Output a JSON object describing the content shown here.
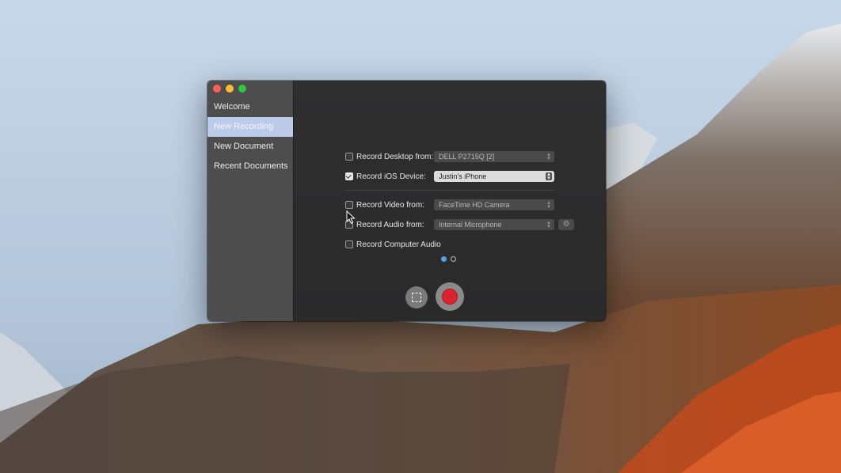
{
  "sidebar": {
    "items": [
      {
        "label": "Welcome",
        "selected": false
      },
      {
        "label": "New Recording",
        "selected": true
      },
      {
        "label": "New Document",
        "selected": false
      },
      {
        "label": "Recent Documents",
        "selected": false
      }
    ]
  },
  "recording": {
    "desktop": {
      "label": "Record Desktop from:",
      "checked": false,
      "value": "DELL P2715Q [2]"
    },
    "ios": {
      "label": "Record iOS Device:",
      "checked": true,
      "value": "Justin's iPhone"
    },
    "video": {
      "label": "Record Video from:",
      "checked": false,
      "value": "FaceTime HD Camera"
    },
    "audio": {
      "label": "Record Audio from:",
      "checked": false,
      "value": "Internal Microphone"
    },
    "computer_audio": {
      "label": "Record Computer Audio",
      "checked": false
    }
  },
  "pager": {
    "current": 1,
    "total": 2
  },
  "icons": {
    "window_close": "close-dot-icon",
    "window_min": "minimize-dot-icon",
    "window_max": "maximize-dot-icon",
    "audio_settings": "gear-icon",
    "select_area": "selection-rectangle-icon",
    "record": "record-icon",
    "popup_chevron": "chevron-up-down-icon"
  },
  "colors": {
    "sidebar_selection": "#bccbea",
    "record_red": "#d9232f",
    "pager_active": "#5aa0d8"
  }
}
